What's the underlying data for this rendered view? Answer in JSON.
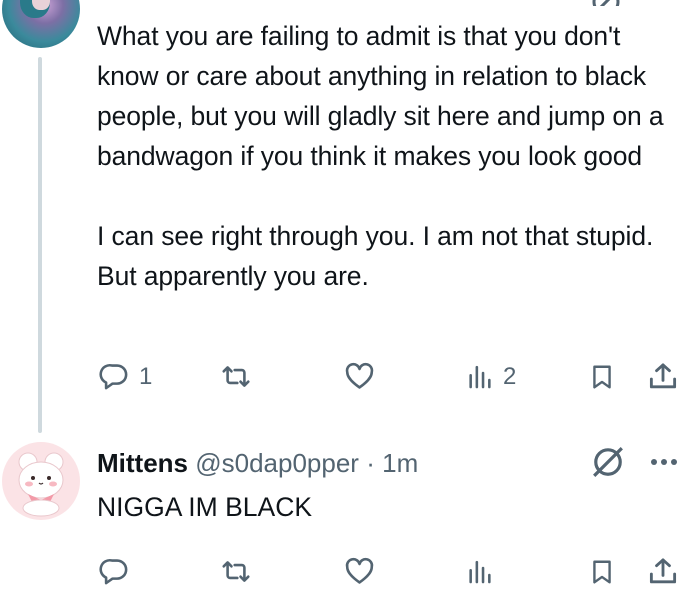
{
  "tweet1": {
    "paragraphs": [
      "What you are failing to admit is that you don't know or care about anything in relation to black people, but you will gladly sit here and jump on a bandwagon if you think it makes you look good",
      "I can see right through you. I am not that stupid. But apparently you are."
    ],
    "reply_count": "1",
    "views_count": "2"
  },
  "tweet2": {
    "name": "Mittens",
    "handle": "@s0dap0pper",
    "separator": "·",
    "time": "1m",
    "text": "NIGGA IM BLACK"
  },
  "colors": {
    "text": "#0f1419",
    "secondary": "#536471",
    "thread_line": "#cfd9de"
  },
  "icons": [
    "reply-icon",
    "retweet-icon",
    "like-icon",
    "views-icon",
    "bookmark-icon",
    "share-icon",
    "grok-icon",
    "more-icon"
  ]
}
